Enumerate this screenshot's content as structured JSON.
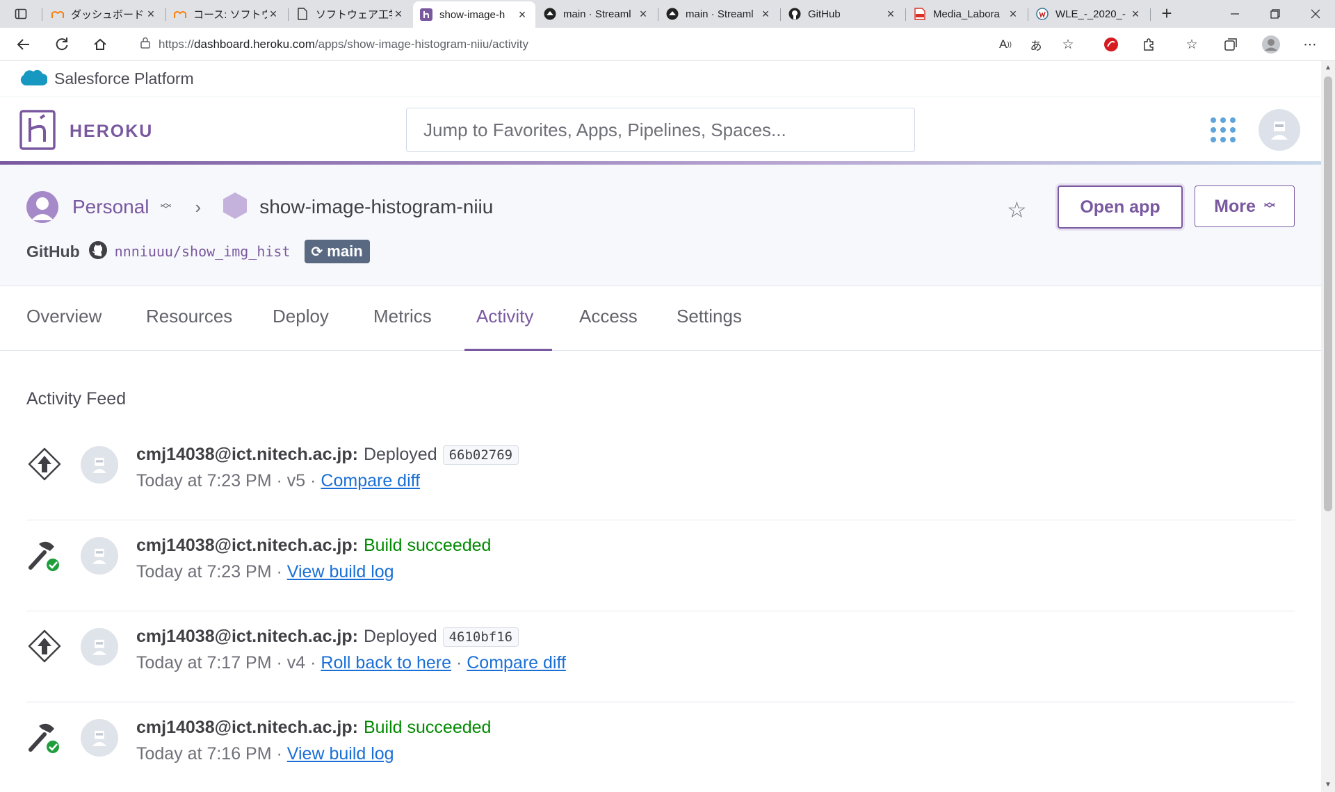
{
  "browser": {
    "tabs": [
      {
        "title": "ダッシュボード",
        "icon": "moodle-icon"
      },
      {
        "title": "コース: ソフトウェ",
        "icon": "moodle-icon"
      },
      {
        "title": "ソフトウェア工学",
        "icon": "document-icon"
      },
      {
        "title": "show-image-h",
        "icon": "heroku-icon",
        "active": true
      },
      {
        "title": "main · Streaml",
        "icon": "streamlit-icon"
      },
      {
        "title": "main · Streaml",
        "icon": "streamlit-icon"
      },
      {
        "title": "GitHub",
        "icon": "github-icon"
      },
      {
        "title": "Media_Labora",
        "icon": "pdf-icon"
      },
      {
        "title": "WLE_-_2020_-",
        "icon": "wiki-icon"
      }
    ],
    "url_prefix": "https://",
    "url_host": "dashboard.heroku.com",
    "url_path": "/apps/show-image-histogram-niiu/activity"
  },
  "salesforce": {
    "label": "Salesforce Platform"
  },
  "header": {
    "brand": "HEROKU",
    "search_placeholder": "Jump to Favorites, Apps, Pipelines, Spaces..."
  },
  "app": {
    "account": "Personal",
    "name": "show-image-histogram-niiu",
    "open_app_label": "Open app",
    "more_label": "More",
    "github_label": "GitHub",
    "repo": "nnniuuu/show_img_hist",
    "branch": "main"
  },
  "nav": {
    "tabs": [
      "Overview",
      "Resources",
      "Deploy",
      "Metrics",
      "Activity",
      "Access",
      "Settings"
    ],
    "active": "Activity"
  },
  "feed": {
    "title": "Activity Feed",
    "items": [
      {
        "type": "deploy",
        "user": "cmj14038@ict.nitech.ac.jp:",
        "action": "Deployed",
        "sha": "66b02769",
        "time": "Today at 7:23 PM",
        "version": "v5",
        "links": [
          "Compare diff"
        ]
      },
      {
        "type": "build",
        "user": "cmj14038@ict.nitech.ac.jp:",
        "action": "Build succeeded",
        "time": "Today at 7:23 PM",
        "links": [
          "View build log"
        ]
      },
      {
        "type": "deploy",
        "user": "cmj14038@ict.nitech.ac.jp:",
        "action": "Deployed",
        "sha": "4610bf16",
        "time": "Today at 7:17 PM",
        "version": "v4",
        "links": [
          "Roll back to here",
          "Compare diff"
        ]
      },
      {
        "type": "build",
        "user": "cmj14038@ict.nitech.ac.jp:",
        "action": "Build succeeded",
        "time": "Today at 7:16 PM",
        "links": [
          "View build log"
        ]
      }
    ]
  },
  "colors": {
    "brand": "#79589f",
    "link": "#1a6fd6",
    "success": "#008a00"
  }
}
